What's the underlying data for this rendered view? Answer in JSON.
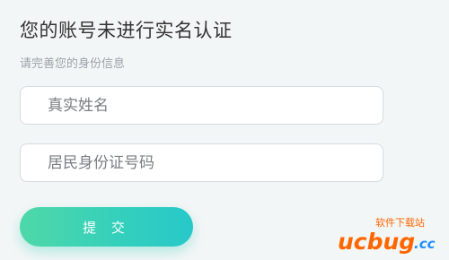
{
  "header": {
    "title": "您的账号未进行实名认证",
    "subtitle": "请完善您的身份信息"
  },
  "form": {
    "name_placeholder": "真实姓名",
    "id_placeholder": "居民身份证号码",
    "submit_label": "提 交"
  },
  "watermark": {
    "top_text": "软件下载站",
    "brand_text": "ucbug",
    "suffix_text": ".cc"
  },
  "colors": {
    "page_background": "#f3f6f6",
    "button_gradient_start": "#4fd8a8",
    "button_gradient_end": "#27c8c9",
    "watermark_orange": "#ff6600",
    "watermark_blue": "#1e90ff"
  }
}
